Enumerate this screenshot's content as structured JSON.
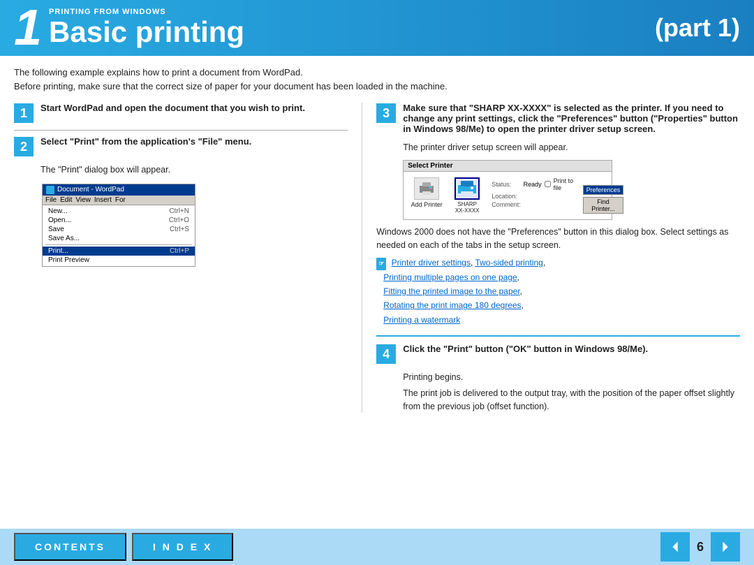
{
  "header": {
    "chapter_number": "1",
    "subtitle": "PRINTING FROM WINDOWS",
    "title": "Basic printing",
    "part_label": "(part 1)"
  },
  "intro": {
    "line1": "The following example explains how to print a document from WordPad.",
    "line2": "Before printing, make sure that the correct size of paper for your document has been loaded in the machine."
  },
  "steps": {
    "step1": {
      "number": "1",
      "text": "Start WordPad and open the document that you wish to print."
    },
    "step2": {
      "number": "2",
      "text_bold": "Select \"Print\" from the application's \"File\" menu.",
      "sub": "The \"Print\" dialog box will appear."
    },
    "step3": {
      "number": "3",
      "text_bold": "Make sure that \"SHARP XX-XXXX\" is selected as the printer. If you need to change any print settings, click the \"Preferences\" button (\"Properties\" button in Windows 98/Me) to open the printer driver setup screen.",
      "sub": "The printer driver setup screen will appear.",
      "note": "Windows 2000 does not have the \"Preferences\" button in this dialog box. Select settings as needed on each of the tabs in the setup screen.",
      "links": [
        {
          "text": "Printer driver settings",
          "href": "#"
        },
        {
          "text": "Two-sided printing",
          "href": "#"
        },
        {
          "text": "Printing multiple pages on one page",
          "href": "#"
        },
        {
          "text": "Fitting the printed image to the paper",
          "href": "#"
        },
        {
          "text": "Rotating the print image 180 degrees",
          "href": "#"
        },
        {
          "text": "Printing a watermark",
          "href": "#"
        }
      ]
    },
    "step4": {
      "number": "4",
      "text_bold": "Click the \"Print\" button (\"OK\" button in Windows 98/Me).",
      "sub1": "Printing begins.",
      "sub2": "The print job is delivered to the output tray, with the position of the paper offset slightly from the previous job (offset function)."
    }
  },
  "wordpad_screenshot": {
    "title": "Document - WordPad",
    "menubar": [
      "File",
      "Edit",
      "View",
      "Insert",
      "For"
    ],
    "items": [
      {
        "label": "New...",
        "shortcut": "Ctrl+N",
        "highlighted": false
      },
      {
        "label": "Open...",
        "shortcut": "Ctrl+O",
        "highlighted": false
      },
      {
        "label": "Save",
        "shortcut": "Ctrl+S",
        "highlighted": false
      },
      {
        "label": "Save As...",
        "shortcut": "",
        "highlighted": false
      },
      {
        "label": "Print...",
        "shortcut": "Ctrl+P",
        "highlighted": true
      },
      {
        "label": "Print Preview",
        "shortcut": "",
        "highlighted": false
      }
    ]
  },
  "printer_screenshot": {
    "title": "Select Printer",
    "printers": [
      {
        "name": "Add Printer",
        "selected": false
      },
      {
        "name": "SHARP XX-XXXX",
        "selected": true
      }
    ],
    "status_label": "Status:",
    "status_value": "Ready",
    "location_label": "Location:",
    "comment_label": "Comment:",
    "print_to_file_label": "Print to file",
    "buttons": [
      "Preferences",
      "Find Printer..."
    ]
  },
  "footer": {
    "contents_label": "CONTENTS",
    "index_label": "I N D E X",
    "page_number": "6"
  }
}
